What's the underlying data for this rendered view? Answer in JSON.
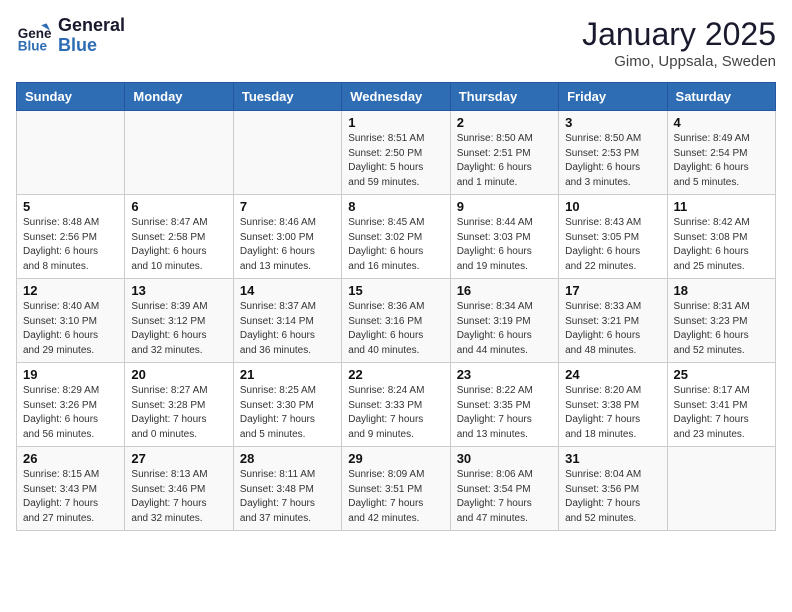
{
  "header": {
    "logo_line1": "General",
    "logo_line2": "Blue",
    "month": "January 2025",
    "location": "Gimo, Uppsala, Sweden"
  },
  "days_of_week": [
    "Sunday",
    "Monday",
    "Tuesday",
    "Wednesday",
    "Thursday",
    "Friday",
    "Saturday"
  ],
  "weeks": [
    [
      {
        "num": "",
        "info": ""
      },
      {
        "num": "",
        "info": ""
      },
      {
        "num": "",
        "info": ""
      },
      {
        "num": "1",
        "info": "Sunrise: 8:51 AM\nSunset: 2:50 PM\nDaylight: 5 hours\nand 59 minutes."
      },
      {
        "num": "2",
        "info": "Sunrise: 8:50 AM\nSunset: 2:51 PM\nDaylight: 6 hours\nand 1 minute."
      },
      {
        "num": "3",
        "info": "Sunrise: 8:50 AM\nSunset: 2:53 PM\nDaylight: 6 hours\nand 3 minutes."
      },
      {
        "num": "4",
        "info": "Sunrise: 8:49 AM\nSunset: 2:54 PM\nDaylight: 6 hours\nand 5 minutes."
      }
    ],
    [
      {
        "num": "5",
        "info": "Sunrise: 8:48 AM\nSunset: 2:56 PM\nDaylight: 6 hours\nand 8 minutes."
      },
      {
        "num": "6",
        "info": "Sunrise: 8:47 AM\nSunset: 2:58 PM\nDaylight: 6 hours\nand 10 minutes."
      },
      {
        "num": "7",
        "info": "Sunrise: 8:46 AM\nSunset: 3:00 PM\nDaylight: 6 hours\nand 13 minutes."
      },
      {
        "num": "8",
        "info": "Sunrise: 8:45 AM\nSunset: 3:02 PM\nDaylight: 6 hours\nand 16 minutes."
      },
      {
        "num": "9",
        "info": "Sunrise: 8:44 AM\nSunset: 3:03 PM\nDaylight: 6 hours\nand 19 minutes."
      },
      {
        "num": "10",
        "info": "Sunrise: 8:43 AM\nSunset: 3:05 PM\nDaylight: 6 hours\nand 22 minutes."
      },
      {
        "num": "11",
        "info": "Sunrise: 8:42 AM\nSunset: 3:08 PM\nDaylight: 6 hours\nand 25 minutes."
      }
    ],
    [
      {
        "num": "12",
        "info": "Sunrise: 8:40 AM\nSunset: 3:10 PM\nDaylight: 6 hours\nand 29 minutes."
      },
      {
        "num": "13",
        "info": "Sunrise: 8:39 AM\nSunset: 3:12 PM\nDaylight: 6 hours\nand 32 minutes."
      },
      {
        "num": "14",
        "info": "Sunrise: 8:37 AM\nSunset: 3:14 PM\nDaylight: 6 hours\nand 36 minutes."
      },
      {
        "num": "15",
        "info": "Sunrise: 8:36 AM\nSunset: 3:16 PM\nDaylight: 6 hours\nand 40 minutes."
      },
      {
        "num": "16",
        "info": "Sunrise: 8:34 AM\nSunset: 3:19 PM\nDaylight: 6 hours\nand 44 minutes."
      },
      {
        "num": "17",
        "info": "Sunrise: 8:33 AM\nSunset: 3:21 PM\nDaylight: 6 hours\nand 48 minutes."
      },
      {
        "num": "18",
        "info": "Sunrise: 8:31 AM\nSunset: 3:23 PM\nDaylight: 6 hours\nand 52 minutes."
      }
    ],
    [
      {
        "num": "19",
        "info": "Sunrise: 8:29 AM\nSunset: 3:26 PM\nDaylight: 6 hours\nand 56 minutes."
      },
      {
        "num": "20",
        "info": "Sunrise: 8:27 AM\nSunset: 3:28 PM\nDaylight: 7 hours\nand 0 minutes."
      },
      {
        "num": "21",
        "info": "Sunrise: 8:25 AM\nSunset: 3:30 PM\nDaylight: 7 hours\nand 5 minutes."
      },
      {
        "num": "22",
        "info": "Sunrise: 8:24 AM\nSunset: 3:33 PM\nDaylight: 7 hours\nand 9 minutes."
      },
      {
        "num": "23",
        "info": "Sunrise: 8:22 AM\nSunset: 3:35 PM\nDaylight: 7 hours\nand 13 minutes."
      },
      {
        "num": "24",
        "info": "Sunrise: 8:20 AM\nSunset: 3:38 PM\nDaylight: 7 hours\nand 18 minutes."
      },
      {
        "num": "25",
        "info": "Sunrise: 8:17 AM\nSunset: 3:41 PM\nDaylight: 7 hours\nand 23 minutes."
      }
    ],
    [
      {
        "num": "26",
        "info": "Sunrise: 8:15 AM\nSunset: 3:43 PM\nDaylight: 7 hours\nand 27 minutes."
      },
      {
        "num": "27",
        "info": "Sunrise: 8:13 AM\nSunset: 3:46 PM\nDaylight: 7 hours\nand 32 minutes."
      },
      {
        "num": "28",
        "info": "Sunrise: 8:11 AM\nSunset: 3:48 PM\nDaylight: 7 hours\nand 37 minutes."
      },
      {
        "num": "29",
        "info": "Sunrise: 8:09 AM\nSunset: 3:51 PM\nDaylight: 7 hours\nand 42 minutes."
      },
      {
        "num": "30",
        "info": "Sunrise: 8:06 AM\nSunset: 3:54 PM\nDaylight: 7 hours\nand 47 minutes."
      },
      {
        "num": "31",
        "info": "Sunrise: 8:04 AM\nSunset: 3:56 PM\nDaylight: 7 hours\nand 52 minutes."
      },
      {
        "num": "",
        "info": ""
      }
    ]
  ]
}
